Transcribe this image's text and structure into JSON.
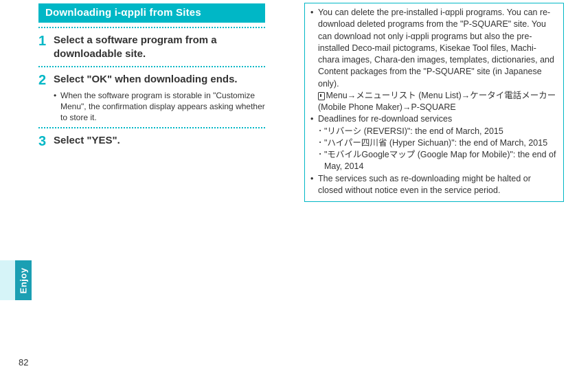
{
  "heading": "Downloading i-αppli from Sites",
  "steps": [
    {
      "num": "1",
      "title": "Select a software program from a downloadable site.",
      "bullets": []
    },
    {
      "num": "2",
      "title": "Select \"OK\" when downloading ends.",
      "bullets": [
        "When the software program is storable in \"Customize Menu\", the confirmation display appears asking whether to store it."
      ]
    },
    {
      "num": "3",
      "title": "Select \"YES\".",
      "bullets": []
    }
  ],
  "right": {
    "p1": "You can delete the pre-installed i-αppli programs. You can re-download deleted programs from the \"P-SQUARE\" site. You can download not only i-αppli programs but also the pre-installed Deco-mail pictograms, Kisekae Tool files, Machi-chara images, Chara-den images, templates, dictionaries, and Content packages from the \"P-SQUARE\" site (in Japanese only).",
    "p1sub": " Menu→メニューリスト (Menu List)→ケータイ電話メーカー (Mobile Phone Maker)→P-SQUARE",
    "p2": "Deadlines for re-download services",
    "p2a": "\"リバーシ (REVERSI)\": the end of March, 2015",
    "p2b": "\"ハイパー四川省 (Hyper Sichuan)\": the end of March, 2015",
    "p2c": "\"モバイルGoogleマップ (Google Map for Mobile)\": the end of May, 2014",
    "p3": "The services such as re-downloading might be halted or closed without notice even in the service period."
  },
  "sideTab": "Enjoy",
  "pageNumber": "82"
}
